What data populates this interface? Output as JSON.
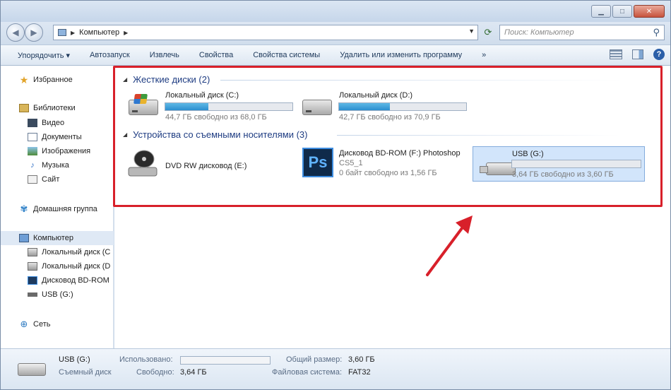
{
  "window": {
    "address_root": "Компьютер",
    "search_placeholder": "Поиск: Компьютер"
  },
  "toolbar": {
    "items": [
      "Упорядочить ▾",
      "Автозапуск",
      "Извлечь",
      "Свойства",
      "Свойства системы",
      "Удалить или изменить программу",
      "»"
    ]
  },
  "sidebar": {
    "favorites": "Избранное",
    "libraries": "Библиотеки",
    "library_items": [
      "Видео",
      "Документы",
      "Изображения",
      "Музыка",
      "Сайт"
    ],
    "homegroup": "Домашняя группа",
    "computer": "Компьютер",
    "computer_items": [
      "Локальный диск (C",
      "Локальный диск (D",
      "Дисковод BD-ROM",
      "USB (G:)"
    ],
    "network": "Сеть"
  },
  "content": {
    "hdd_group": "Жесткие диски (2)",
    "removable_group": "Устройства со съемными носителями (3)",
    "drives": [
      {
        "name": "Локальный диск (C:)",
        "free": "44,7 ГБ свободно из 68,0 ГБ",
        "used_fraction": 0.34
      },
      {
        "name": "Локальный диск (D:)",
        "free": "42,7 ГБ свободно из 70,9 ГБ",
        "used_fraction": 0.4
      }
    ],
    "removable": [
      {
        "name": "DVD RW дисковод (E:)"
      },
      {
        "name": "Дисковод BD-ROM (F:) Photoshop",
        "name2": "CS5_1",
        "free": "0 байт свободно из 1,56 ГБ"
      },
      {
        "name": "USB (G:)",
        "free": "3,64 ГБ свободно из 3,60 ГБ",
        "used_fraction": 0.0
      }
    ]
  },
  "status": {
    "name": "USB (G:)",
    "type": "Съемный диск",
    "used_label": "Использовано:",
    "free_label": "Свободно:",
    "free_value": "3,64 ГБ",
    "total_label": "Общий размер:",
    "total_value": "3,60 ГБ",
    "fs_label": "Файловая система:",
    "fs_value": "FAT32",
    "used_fraction": 0.0
  },
  "colors": {
    "highlight": "#d8202a",
    "accent": "#2c8fcf"
  }
}
